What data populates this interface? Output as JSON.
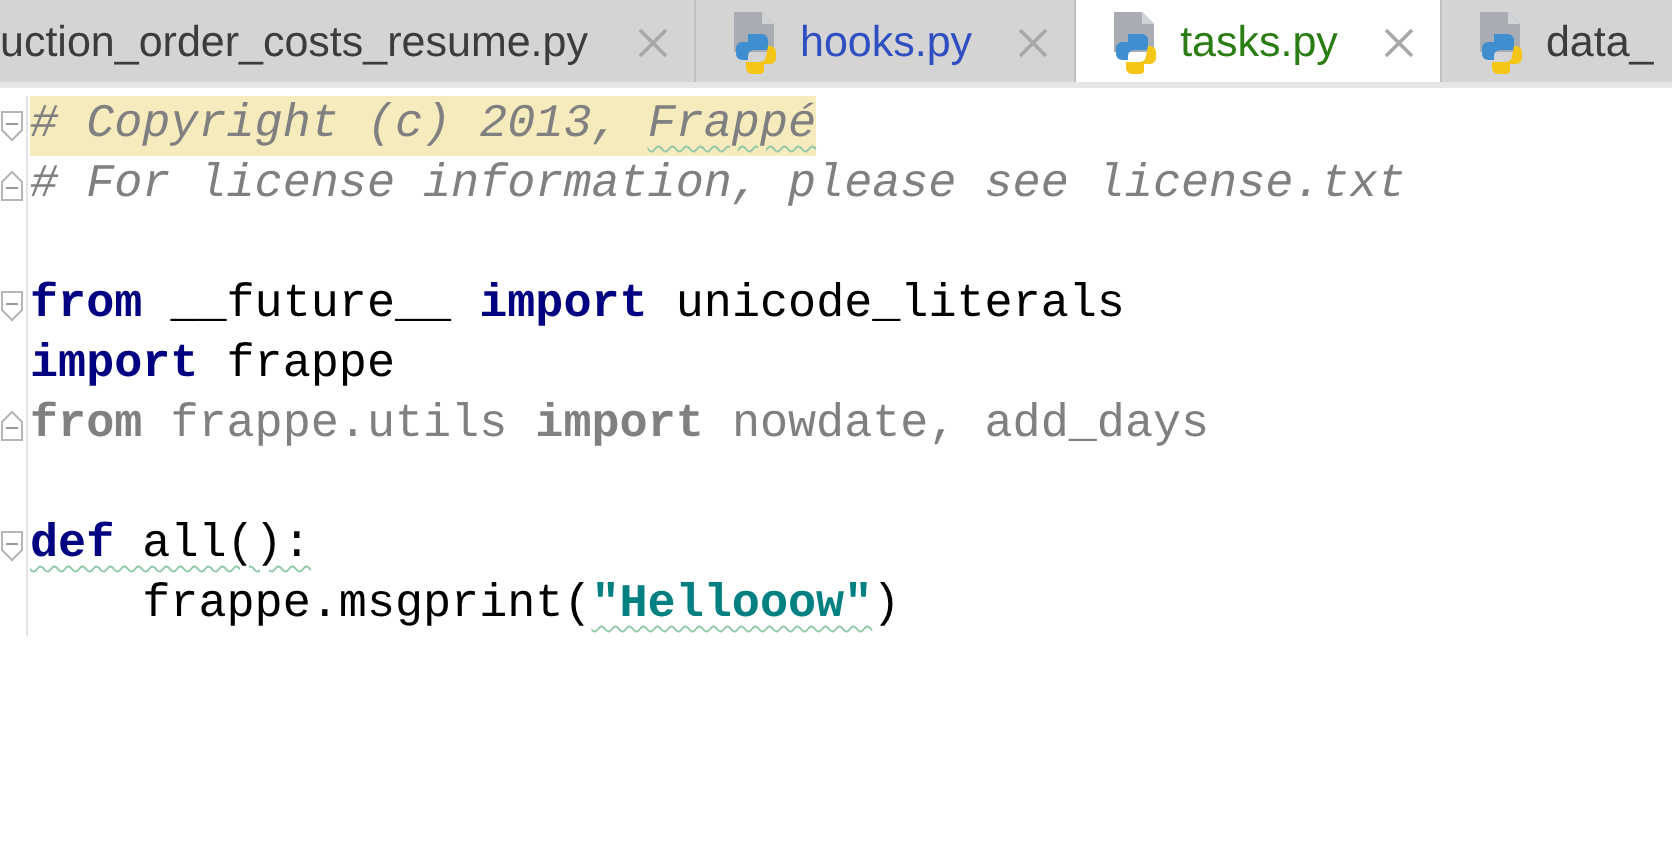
{
  "tabs": [
    {
      "label": "uction_order_costs_resume.py",
      "selected": false,
      "color": "#3c3c3c",
      "icon": false,
      "closable": true
    },
    {
      "label": "hooks.py",
      "selected": false,
      "color": "#2f4fc0",
      "icon": true,
      "closable": true
    },
    {
      "label": "tasks.py",
      "selected": true,
      "color": "#2a7d12",
      "icon": true,
      "closable": true
    },
    {
      "label": "data_",
      "selected": false,
      "color": "#3c3c3c",
      "icon": true,
      "closable": false
    }
  ],
  "editor": {
    "lines": [
      {
        "kind": "code",
        "highlighted": true,
        "fold_start": true,
        "fold_end": false,
        "tokens": [
          {
            "kind": "comment",
            "text": "# Copyright (c) 2013, "
          },
          {
            "kind": "comment",
            "text": "Frappé",
            "squiggle": true
          }
        ]
      },
      {
        "kind": "code",
        "highlighted": false,
        "fold_start": false,
        "fold_end": true,
        "tokens": [
          {
            "kind": "comment",
            "text": "# For license information, please see license.txt"
          }
        ]
      },
      {
        "kind": "blank"
      },
      {
        "kind": "code",
        "highlighted": false,
        "fold_start": true,
        "fold_end": false,
        "tokens": [
          {
            "kind": "keyword",
            "text": "from"
          },
          {
            "kind": "text",
            "text": " __future__ "
          },
          {
            "kind": "keyword",
            "text": "import"
          },
          {
            "kind": "text",
            "text": " unicode_literals"
          }
        ]
      },
      {
        "kind": "code",
        "highlighted": false,
        "fold_start": false,
        "fold_end": false,
        "tokens": [
          {
            "kind": "keyword",
            "text": "import"
          },
          {
            "kind": "text",
            "text": " frappe"
          }
        ]
      },
      {
        "kind": "code",
        "highlighted": false,
        "fold_start": false,
        "fold_end": true,
        "tokens": [
          {
            "kind": "unused-keyword",
            "text": "from"
          },
          {
            "kind": "unused",
            "text": " frappe.utils "
          },
          {
            "kind": "unused-keyword",
            "text": "import"
          },
          {
            "kind": "unused",
            "text": " nowdate, add_days"
          }
        ]
      },
      {
        "kind": "blank"
      },
      {
        "kind": "code",
        "highlighted": false,
        "fold_start": true,
        "fold_end": false,
        "tokens": [
          {
            "kind": "keyword",
            "text": "def",
            "squiggle": true
          },
          {
            "kind": "text",
            "text": " all():",
            "squiggle": true
          }
        ]
      },
      {
        "kind": "code",
        "highlighted": false,
        "fold_start": false,
        "fold_end": false,
        "tokens": [
          {
            "kind": "text",
            "text": "    frappe.msgprint("
          },
          {
            "kind": "string",
            "text": "\"Hellooow\"",
            "squiggle": true
          },
          {
            "kind": "text",
            "text": ")"
          }
        ]
      }
    ]
  }
}
